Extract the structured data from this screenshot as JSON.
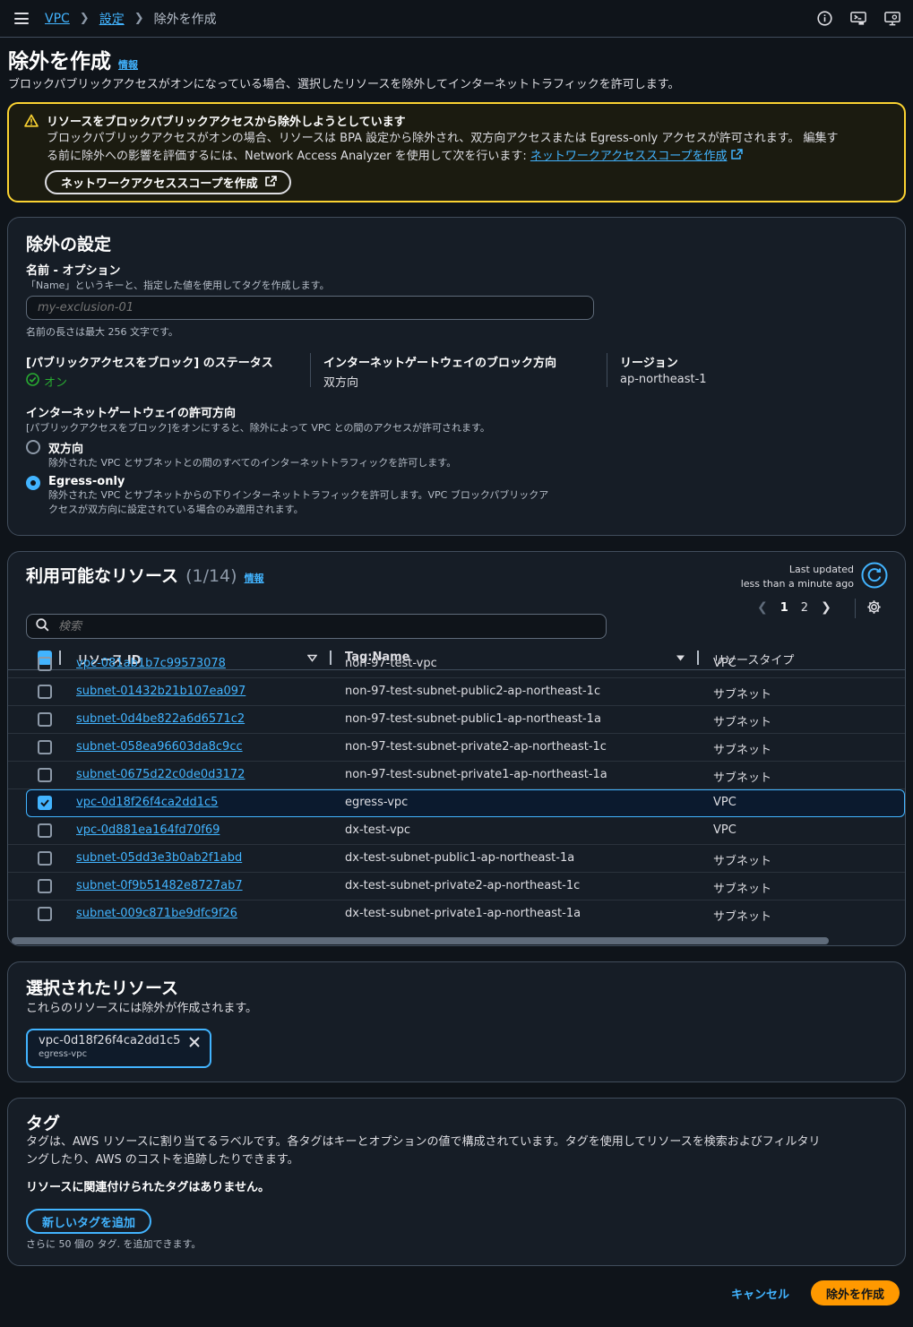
{
  "breadcrumb": {
    "vpc": "VPC",
    "settings": "設定",
    "current": "除外を作成"
  },
  "header": {
    "title": "除外を作成",
    "info": "情報",
    "description": "ブロックパブリックアクセスがオンになっている場合、選択したリソースを除外してインターネットトラフィックを許可します。"
  },
  "warning": {
    "title": "リソースをブロックパブリックアクセスから除外しようとしています",
    "body_line1": "ブロックパブリックアクセスがオンの場合、リソースは BPA 設定から除外され、双方向アクセスまたは Egress-only アクセスが許可されます。 編集す",
    "body_line2_prefix": "る前に除外への影響を評価するには、Network Access Analyzer を使用して次を行います: ",
    "body_link": "ネットワークアクセススコープを作成",
    "button": "ネットワークアクセススコープを作成"
  },
  "exclusion_settings": {
    "title": "除外の設定",
    "name_label": "名前 - オプション",
    "name_hint": "「Name」というキーと、指定した値を使用してタグを作成します。",
    "name_placeholder": "my-exclusion-01",
    "name_constraint": "名前の長さは最大 256 文字です。",
    "bpa_status_label": "[パブリックアクセスをブロック] のステータス",
    "bpa_status_value": "オン",
    "igw_block_label": "インターネットゲートウェイのブロック方向",
    "igw_block_value": "双方向",
    "region_label": "リージョン",
    "region_value": "ap-northeast-1",
    "allow_direction_label": "インターネットゲートウェイの許可方向",
    "allow_direction_hint": "[パブリックアクセスをブロック]をオンにすると、除外によって VPC との間のアクセスが許可されます。",
    "options": [
      {
        "label": "双方向",
        "desc": "除外された VPC とサブネットとの間のすべてのインターネットトラフィックを許可します。",
        "desc2": ""
      },
      {
        "label": "Egress-only",
        "desc": "除外された VPC とサブネットからの下りインターネットトラフィックを許可します。VPC ブロックパブリックア",
        "desc2": "クセスが双方向に設定されている場合のみ適用されます。"
      }
    ]
  },
  "resources": {
    "title": "利用可能なリソース",
    "count": "(1/14)",
    "info": "情報",
    "last_updated_label": "Last updated",
    "last_updated_value": "less than a minute ago",
    "search_placeholder": "検索",
    "pages": [
      "1",
      "2"
    ],
    "columns": {
      "id": "リソース ID",
      "tag": "Tag:Name",
      "type": "リソースタイプ"
    },
    "rows": [
      {
        "id": "vpc-081ab1b7c99573078",
        "tag": "non-97-test-vpc",
        "type": "VPC"
      },
      {
        "id": "subnet-01432b21b107ea097",
        "tag": "non-97-test-subnet-public2-ap-northeast-1c",
        "type": "サブネット"
      },
      {
        "id": "subnet-0d4be822a6d6571c2",
        "tag": "non-97-test-subnet-public1-ap-northeast-1a",
        "type": "サブネット"
      },
      {
        "id": "subnet-058ea96603da8c9cc",
        "tag": "non-97-test-subnet-private2-ap-northeast-1c",
        "type": "サブネット"
      },
      {
        "id": "subnet-0675d22c0de0d3172",
        "tag": "non-97-test-subnet-private1-ap-northeast-1a",
        "type": "サブネット"
      },
      {
        "id": "vpc-0d18f26f4ca2dd1c5",
        "tag": "egress-vpc",
        "type": "VPC"
      },
      {
        "id": "vpc-0d881ea164fd70f69",
        "tag": "dx-test-vpc",
        "type": "VPC"
      },
      {
        "id": "subnet-05dd3e3b0ab2f1abd",
        "tag": "dx-test-subnet-public1-ap-northeast-1a",
        "type": "サブネット"
      },
      {
        "id": "subnet-0f9b51482e8727ab7",
        "tag": "dx-test-subnet-private2-ap-northeast-1c",
        "type": "サブネット"
      },
      {
        "id": "subnet-009c871be9dfc9f26",
        "tag": "dx-test-subnet-private1-ap-northeast-1a",
        "type": "サブネット"
      }
    ]
  },
  "selected": {
    "title": "選択されたリソース",
    "desc": "これらのリソースには除外が作成されます。",
    "token_id": "vpc-0d18f26f4ca2dd1c5",
    "token_name": "egress-vpc"
  },
  "tags": {
    "title": "タグ",
    "desc_line1": "タグは、AWS リソースに割り当てるラベルです。各タグはキーとオプションの値で構成されています。タグを使用してリソースを検索およびフィルタリ",
    "desc_line2": "ングしたり、AWS のコストを追跡したりできます。",
    "empty": "リソースに関連付けられたタグはありません。",
    "add_button": "新しいタグを追加",
    "remaining": "さらに 50 個の タグ. を追加できます。"
  },
  "footer": {
    "cancel": "キャンセル",
    "create": "除外を作成"
  },
  "colors": {
    "accent": "#42b4ff",
    "primary": "#ff9900",
    "warning": "#fbd332",
    "success": "#29ad32"
  }
}
